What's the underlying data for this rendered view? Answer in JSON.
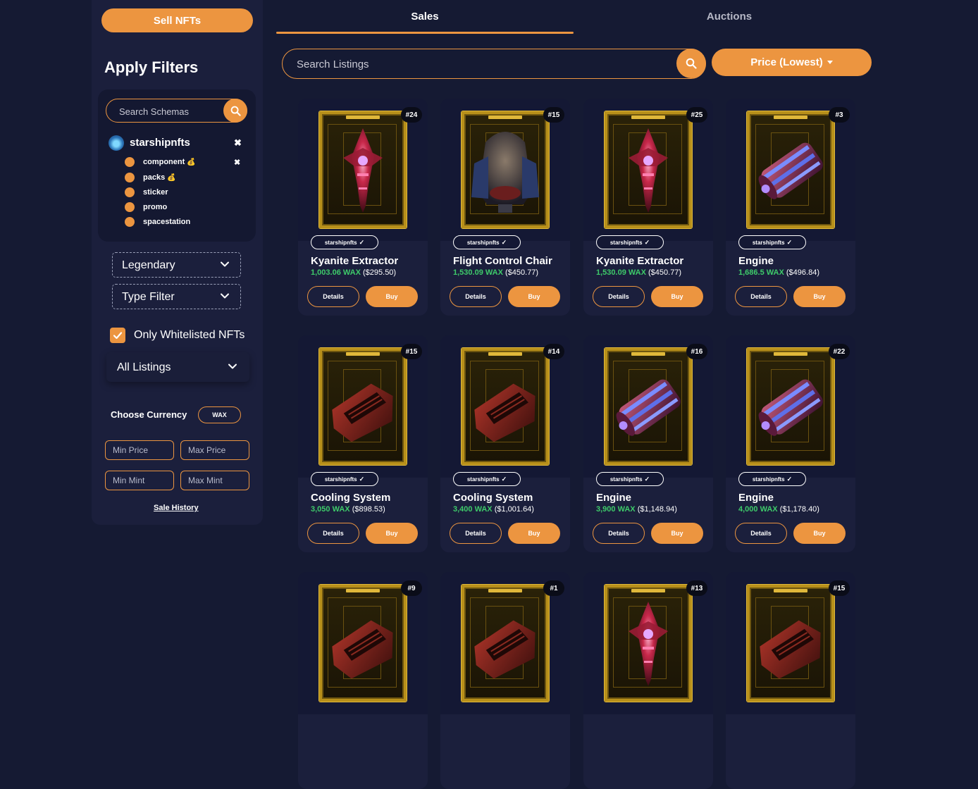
{
  "sidebar": {
    "sell_label": "Sell NFTs",
    "filters_title": "Apply Filters",
    "schema_search_placeholder": "Search Schemas",
    "collection": {
      "name": "starshipnfts"
    },
    "schemas": [
      {
        "label": "component",
        "token": "💰"
      },
      {
        "label": "packs",
        "token": "💰"
      },
      {
        "label": "sticker",
        "token": ""
      },
      {
        "label": "promo",
        "token": ""
      },
      {
        "label": "spacestation",
        "token": ""
      }
    ],
    "rarity_filter": "Legendary",
    "type_filter": "Type Filter",
    "whitelist_label": "Only Whitelisted NFTs",
    "whitelist_checked": true,
    "listings_filter": "All Listings",
    "currency_label": "Choose Currency",
    "currency_value": "WAX",
    "min_price_placeholder": "Min Price",
    "max_price_placeholder": "Max Price",
    "min_mint_placeholder": "Min Mint",
    "max_mint_placeholder": "Max Mint",
    "sale_history_label": "Sale History"
  },
  "tabs": {
    "sales": "Sales",
    "auctions": "Auctions",
    "active": "sales"
  },
  "search": {
    "placeholder": "Search Listings"
  },
  "sort": {
    "label": "Price (Lowest)"
  },
  "cards": [
    {
      "mint": "#24",
      "collection": "starshipnfts",
      "name": "Kyanite Extractor",
      "wax": "1,003.06 WAX",
      "usd": "($295.50)",
      "art": "extractor",
      "details": "Details",
      "buy": "Buy"
    },
    {
      "mint": "#15",
      "collection": "starshipnfts",
      "name": "Flight Control Chair",
      "wax": "1,530.09 WAX",
      "usd": "($450.77)",
      "art": "chair",
      "details": "Details",
      "buy": "Buy"
    },
    {
      "mint": "#25",
      "collection": "starshipnfts",
      "name": "Kyanite Extractor",
      "wax": "1,530.09 WAX",
      "usd": "($450.77)",
      "art": "extractor",
      "details": "Details",
      "buy": "Buy"
    },
    {
      "mint": "#3",
      "collection": "starshipnfts",
      "name": "Engine",
      "wax": "1,686.5 WAX",
      "usd": "($496.84)",
      "art": "engine",
      "details": "Details",
      "buy": "Buy"
    },
    {
      "mint": "#15",
      "collection": "starshipnfts",
      "name": "Cooling System",
      "wax": "3,050 WAX",
      "usd": "($898.53)",
      "art": "cooling",
      "details": "Details",
      "buy": "Buy"
    },
    {
      "mint": "#14",
      "collection": "starshipnfts",
      "name": "Cooling System",
      "wax": "3,400 WAX",
      "usd": "($1,001.64)",
      "art": "cooling",
      "details": "Details",
      "buy": "Buy"
    },
    {
      "mint": "#16",
      "collection": "starshipnfts",
      "name": "Engine",
      "wax": "3,900 WAX",
      "usd": "($1,148.94)",
      "art": "engine",
      "details": "Details",
      "buy": "Buy"
    },
    {
      "mint": "#22",
      "collection": "starshipnfts",
      "name": "Engine",
      "wax": "4,000 WAX",
      "usd": "($1,178.40)",
      "art": "engine",
      "details": "Details",
      "buy": "Buy"
    },
    {
      "mint": "#9",
      "collection": "",
      "name": "",
      "wax": "",
      "usd": "",
      "art": "cooling",
      "details": "",
      "buy": ""
    },
    {
      "mint": "#1",
      "collection": "",
      "name": "",
      "wax": "",
      "usd": "",
      "art": "cooling",
      "details": "",
      "buy": ""
    },
    {
      "mint": "#13",
      "collection": "",
      "name": "",
      "wax": "",
      "usd": "",
      "art": "extractor",
      "details": "",
      "buy": ""
    },
    {
      "mint": "#15",
      "collection": "",
      "name": "",
      "wax": "",
      "usd": "",
      "art": "cooling",
      "details": "",
      "buy": ""
    }
  ],
  "colors": {
    "accent": "#ec9540",
    "background": "#151a33",
    "panel": "#1b1f3c",
    "wax_green": "#3ecb6a",
    "frame_gold": "#b8901a"
  },
  "icons": {
    "search": "search-icon",
    "close": "close-icon",
    "chevron": "chevron-down-icon",
    "check": "check-icon",
    "verified": "verified-check-icon"
  }
}
